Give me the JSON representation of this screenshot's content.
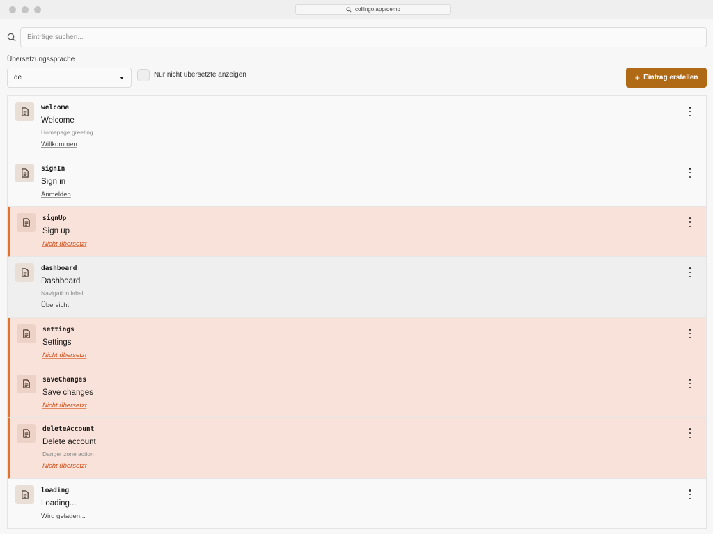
{
  "browser": {
    "url": "collingo.app/demo"
  },
  "search": {
    "placeholder": "Einträge suchen..."
  },
  "filters": {
    "language_label": "Übersetzungssprache",
    "language_value": "de",
    "only_untranslated_label": "Nur nicht übersetzte anzeigen",
    "create_button_label": "Eintrag erstellen"
  },
  "entries": [
    {
      "key": "welcome",
      "source": "Welcome",
      "description": "Homepage greeting",
      "translation": "Willkommen",
      "status": "translated"
    },
    {
      "key": "signIn",
      "source": "Sign in",
      "description": "",
      "translation": "Anmelden",
      "status": "translated"
    },
    {
      "key": "signUp",
      "source": "Sign up",
      "description": "",
      "translation": "Nicht übersetzt",
      "status": "untranslated"
    },
    {
      "key": "dashboard",
      "source": "Dashboard",
      "description": "Navigation label",
      "translation": "Übersicht",
      "status": "translated"
    },
    {
      "key": "settings",
      "source": "Settings",
      "description": "",
      "translation": "Nicht übersetzt",
      "status": "untranslated"
    },
    {
      "key": "saveChanges",
      "source": "Save changes",
      "description": "",
      "translation": "Nicht übersetzt",
      "status": "untranslated"
    },
    {
      "key": "deleteAccount",
      "source": "Delete account",
      "description": "Danger zone action",
      "translation": "Nicht übersetzt",
      "status": "untranslated"
    },
    {
      "key": "loading",
      "source": "Loading...",
      "description": "",
      "translation": "Wird geladen...",
      "status": "translated"
    }
  ],
  "colors": {
    "accent": "#b06a16",
    "untranslated_bg": "#f8e2d9",
    "untranslated_border": "#e0712e",
    "untranslated_text": "#d2521d"
  }
}
